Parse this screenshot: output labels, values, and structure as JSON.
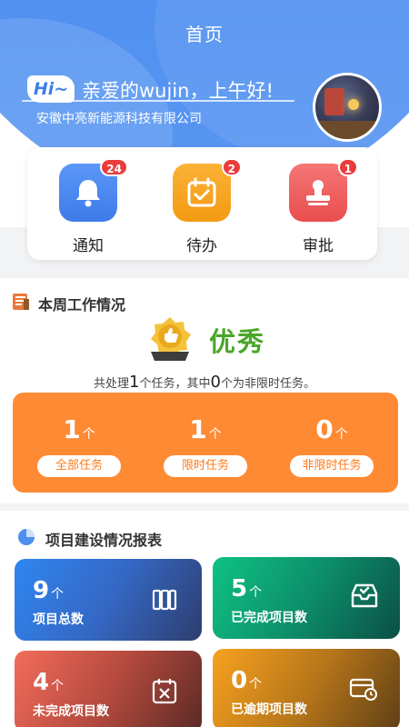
{
  "header": {
    "title": "首页",
    "hi": "Hi~",
    "greeting": "亲爱的wujin，上午好!",
    "company": "安徽中亮新能源科技有限公司"
  },
  "quick_actions": [
    {
      "label": "通知",
      "badge": "24",
      "icon": "bell-icon",
      "color": "#4b86f2"
    },
    {
      "label": "待办",
      "badge": "2",
      "icon": "calendar-check-icon",
      "color": "#f7a21d"
    },
    {
      "label": "审批",
      "badge": "1",
      "icon": "stamp-icon",
      "color": "#f05a5a"
    }
  ],
  "weekly": {
    "title": "本周工作情况",
    "rating": "优秀",
    "summary_pre": "共处理",
    "total": "1",
    "summary_mid": "个任务，其中",
    "unlimited_count": "0",
    "summary_post": "个为非限时任务。",
    "stats": [
      {
        "value": "1",
        "unit": "个",
        "label": "全部任务"
      },
      {
        "value": "1",
        "unit": "个",
        "label": "限时任务"
      },
      {
        "value": "0",
        "unit": "个",
        "label": "非限时任务"
      }
    ]
  },
  "projects": {
    "title": "项目建设情况报表",
    "cards": [
      {
        "value": "9",
        "unit": "个",
        "label": "项目总数",
        "icon": "books-icon"
      },
      {
        "value": "5",
        "unit": "个",
        "label": "已完成项目数",
        "icon": "inbox-check-icon"
      },
      {
        "value": "4",
        "unit": "个",
        "label": "未完成项目数",
        "icon": "calendar-x-icon"
      },
      {
        "value": "0",
        "unit": "个",
        "label": "已逾期项目数",
        "icon": "card-clock-icon"
      }
    ]
  },
  "colors": {
    "accent": "#4f8ff0",
    "orange": "#ff8a34",
    "excellent": "#49a629"
  }
}
